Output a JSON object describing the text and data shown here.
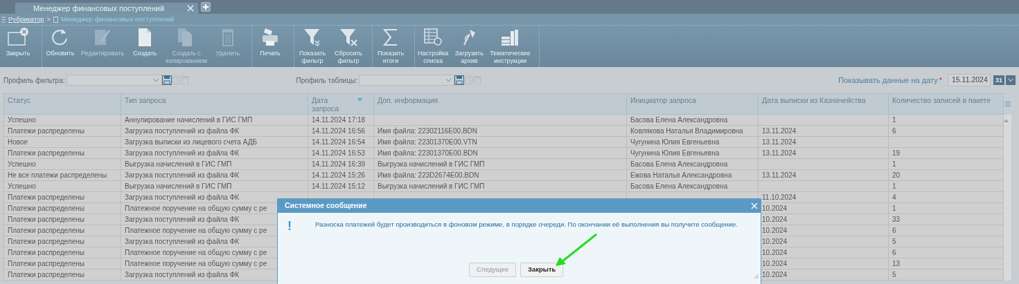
{
  "tab": {
    "title": "Менеджер финансовых поступлений"
  },
  "breadcrumb": {
    "root": "Рубрикатор",
    "separator": ">",
    "current": "Менеджер финансовых поступлений"
  },
  "toolbar": [
    {
      "buttons": [
        {
          "kind": "close",
          "label": "Закрыть",
          "disabled": false
        }
      ]
    },
    {
      "buttons": [
        {
          "kind": "refresh",
          "label": "Обновить",
          "disabled": false
        },
        {
          "kind": "edit",
          "label": "Редактировать",
          "disabled": true
        },
        {
          "kind": "create",
          "label": "Создать",
          "disabled": false
        },
        {
          "kind": "copy",
          "label": "Создать с\nкопированием",
          "disabled": true
        },
        {
          "kind": "delete",
          "label": "Удалить",
          "disabled": true
        }
      ]
    },
    {
      "buttons": [
        {
          "kind": "print",
          "label": "Печать",
          "disabled": false
        }
      ]
    },
    {
      "buttons": [
        {
          "kind": "filter",
          "label": "Показать\nфильтр",
          "disabled": false
        },
        {
          "kind": "filter-reset",
          "label": "Сбросить\nфильтр",
          "disabled": false
        }
      ]
    },
    {
      "buttons": [
        {
          "kind": "sum",
          "label": "Показать\nитоги",
          "disabled": false
        }
      ]
    },
    {
      "buttons": [
        {
          "kind": "settings",
          "label": "Настройка\nсписка",
          "disabled": false
        },
        {
          "kind": "upload",
          "label": "Загрузить\nархив",
          "disabled": false
        },
        {
          "kind": "books",
          "label": "Тематические\nинструкции",
          "disabled": false
        }
      ]
    }
  ],
  "filters": {
    "filter_profile_label": "Профиль фильтра:",
    "table_profile_label": "Профиль таблицы:",
    "date_label": "Показывать данные на дату",
    "required_mark": "*",
    "date_value": "15.11.2024",
    "calendar_button": "31"
  },
  "table": {
    "columns": [
      {
        "title": "Статус",
        "sorted": false
      },
      {
        "title": "Тип запроса",
        "sorted": false
      },
      {
        "title": "Дата\nзапроса",
        "sorted": true
      },
      {
        "title": "Доп. информация",
        "sorted": false
      },
      {
        "title": "Инициатор запроса",
        "sorted": false
      },
      {
        "title": "Дата выписки из Казначейства",
        "sorted": false
      },
      {
        "title": "Количество записей в пакете",
        "sorted": false
      }
    ],
    "rows": [
      [
        "Успешно",
        "Аннулирование начислений в ГИС ГМП",
        "14.11.2024 17:18",
        null,
        "Басова Елена Александровна",
        null,
        "1"
      ],
      [
        "Платежи распределены",
        "Загрузка поступлений из файла ФК",
        "14.11.2024 16:56",
        "Имя файла: 22302116E00.BDN",
        "Ковлякова Наталья Владимировна",
        "13.11.2024",
        "6"
      ],
      [
        "Новое",
        "Загрузка выписки из лицевого счета АДБ",
        "14.11.2024 16:54",
        "Имя файла: 22301370E00.VTN",
        "Чугунина Юлия Евгеньевна",
        "13.11.2024",
        null
      ],
      [
        "Платежи распределены",
        "Загрузка поступлений из файла ФК",
        "14.11.2024 16:53",
        "Имя файла: 22301370E00.BDN",
        "Чугунина Юлия Евгеньевна",
        "13.11.2024",
        "19"
      ],
      [
        "Успешно",
        "Выгрузка начислений в ГИС ГМП",
        "14.11.2024 16:39",
        "Выгрузка начислений в ГИС ГМП",
        "Басова Елена Александровна",
        null,
        "1"
      ],
      [
        "Не все платежи распределены",
        "Загрузка поступлений из файла ФК",
        "14.11.2024 15:26",
        "Имя файла: 223D2674E00.BDN",
        "Ежова Наталья Александровна",
        "13.11.2024",
        "20"
      ],
      [
        "Успешно",
        "Выгрузка начислений в ГИС ГМП",
        "14.11.2024 15:12",
        "Выгрузка начислений в ГИС ГМП",
        "Басова Елена Александровна",
        null,
        "1"
      ],
      [
        "Платежи распределены",
        "Загрузка поступлений из файла ФК",
        null,
        null,
        null,
        "11.10.2024",
        "4"
      ],
      [
        "Платежи распределены",
        "Платежное поручение на общую сумму с ре",
        null,
        null,
        null,
        "10.2024",
        "1"
      ],
      [
        "Платежи распределены",
        "Загрузка поступлений из файла ФК",
        null,
        null,
        null,
        "10.2024",
        "33"
      ],
      [
        "Платежи распределены",
        "Платежное поручение на общую сумму с ре",
        null,
        null,
        null,
        "10.2024",
        "6"
      ],
      [
        "Платежи распределены",
        "Загрузка поступлений из файла ФК",
        null,
        null,
        null,
        "10.2024",
        "5"
      ],
      [
        "Платежи распределены",
        "Платежное поручение на общую сумму с ре",
        null,
        null,
        null,
        "10.2024",
        "6"
      ],
      [
        "Платежи распределены",
        "Платежное поручение на общую сумму с ре",
        null,
        null,
        null,
        "10.2024",
        "13"
      ],
      [
        "Платежи распределены",
        "Загрузка поступлений из файла ФК",
        null,
        null,
        null,
        "10.2024",
        "5"
      ]
    ]
  },
  "dialog": {
    "title": "Системное сообщение",
    "icon": "!",
    "message": "Разноска платежей будет производиться в фоновом режиме, в порядке очереди. По окончании её выполнения вы получите сообщение.",
    "buttons": [
      {
        "label": "Следущее",
        "disabled": true
      },
      {
        "label": "Закрыть",
        "disabled": false
      }
    ]
  }
}
